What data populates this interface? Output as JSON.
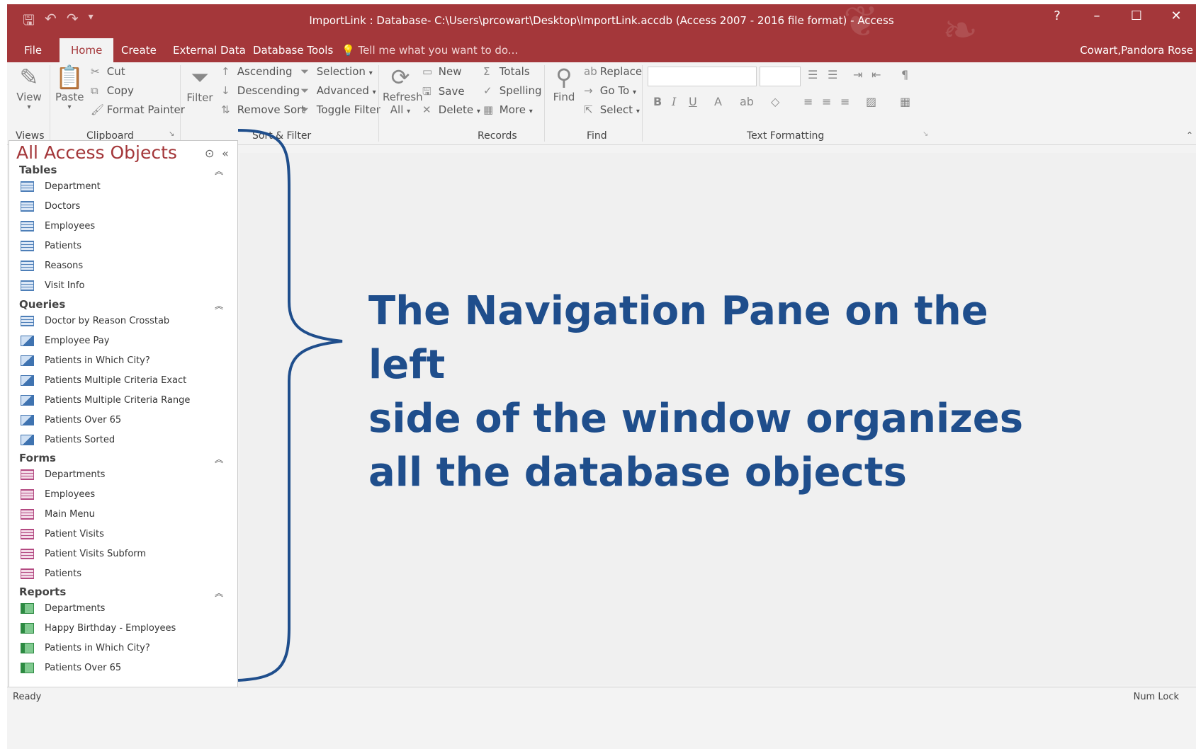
{
  "window": {
    "title": "ImportLink : Database- C:\\Users\\prcowart\\Desktop\\ImportLink.accdb (Access 2007 - 2016 file format) - Access",
    "help": "?",
    "minimize": "–",
    "maximize": "☐",
    "close": "✕",
    "accent_color": "#a4373a"
  },
  "tabs": {
    "file": "File",
    "home": "Home",
    "create": "Create",
    "external": "External Data",
    "dbtools": "Database Tools",
    "tellme": "Tell me what you want to do...",
    "user": "Cowart,Pandora Rose"
  },
  "ribbon": {
    "view": "View",
    "paste": "Paste",
    "cut": "Cut",
    "copy": "Copy",
    "format_painter": "Format Painter",
    "filter": "Filter",
    "ascending": "Ascending",
    "descending": "Descending",
    "remove_sort": "Remove Sort",
    "selection": "Selection",
    "advanced": "Advanced",
    "toggle_filter": "Toggle Filter",
    "refresh": "Refresh",
    "refresh_all": "All",
    "new": "New",
    "save": "Save",
    "delete": "Delete",
    "totals": "Totals",
    "spelling": "Spelling",
    "more": "More",
    "find": "Find",
    "replace": "Replace",
    "goto": "Go To",
    "select": "Select",
    "groups": {
      "views": "Views",
      "clipboard": "Clipboard",
      "sort_filter": "Sort & Filter",
      "records": "Records",
      "find": "Find",
      "text_formatting": "Text Formatting"
    }
  },
  "nav": {
    "title": "All Access Objects",
    "sections": {
      "tables": {
        "label": "Tables",
        "items": [
          "Department",
          "Doctors",
          "Employees",
          "Patients",
          "Reasons",
          "Visit Info"
        ]
      },
      "queries": {
        "label": "Queries",
        "items": [
          "Doctor by Reason Crosstab",
          "Employee Pay",
          "Patients in Which City?",
          "Patients Multiple Criteria Exact",
          "Patients Multiple Criteria Range",
          "Patients Over 65",
          "Patients Sorted"
        ]
      },
      "forms": {
        "label": "Forms",
        "items": [
          "Departments",
          "Employees",
          "Main Menu",
          "Patient Visits",
          "Patient Visits Subform",
          "Patients"
        ]
      },
      "reports": {
        "label": "Reports",
        "items": [
          "Departments",
          "Happy Birthday - Employees",
          "Patients in Which City?",
          "Patients Over 65"
        ]
      }
    }
  },
  "callout": {
    "line1": "The Navigation Pane on the left",
    "line2": "side of the window organizes",
    "line3": "all the database objects",
    "color": "#1f4e8c"
  },
  "status": {
    "left": "Ready",
    "right": "Num Lock"
  }
}
